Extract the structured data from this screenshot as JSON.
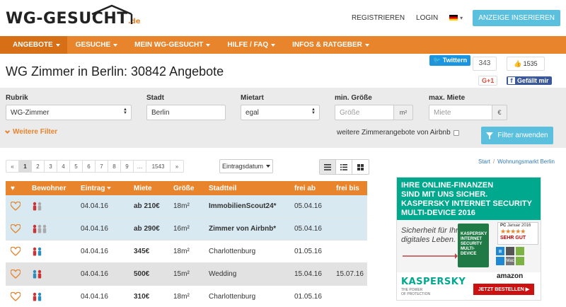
{
  "header": {
    "logo_main": "WG-GESUCHT",
    "logo_suffix": ".de",
    "register": "REGISTRIEREN",
    "login": "LOGIN",
    "cta": "ANZEIGE INSERIEREN"
  },
  "nav": {
    "items": [
      {
        "label": "ANGEBOTE"
      },
      {
        "label": "GESUCHE"
      },
      {
        "label": "MEIN WG-GESUCHT"
      },
      {
        "label": "HILFE / FAQ"
      },
      {
        "label": "INFOS & RATGEBER"
      }
    ]
  },
  "page": {
    "title": "WG Zimmer in Berlin: 30842 Angebote"
  },
  "social": {
    "twitter": "Twittern",
    "twitter_count": "343",
    "gplus": "G+1",
    "like_count": "1535",
    "fb_like": "Gefällt mir"
  },
  "filter": {
    "rubrik_label": "Rubrik",
    "rubrik_value": "WG-Zimmer",
    "stadt_label": "Stadt",
    "stadt_value": "Berlin",
    "mietart_label": "Mietart",
    "mietart_value": "egal",
    "groesse_label": "min. Größe",
    "groesse_placeholder": "Größe",
    "groesse_unit": "m²",
    "miete_label": "max. Miete",
    "miete_placeholder": "Miete",
    "miete_unit": "€",
    "more_filters": "Weitere Filter",
    "airbnb_label": "weitere Zimmerangebote von Airbnb",
    "apply": "Filter anwenden"
  },
  "pagination": {
    "prev": "«",
    "pages": [
      "1",
      "2",
      "3",
      "4",
      "5",
      "6",
      "7",
      "8",
      "9",
      "…",
      "1543"
    ],
    "next": "»",
    "active": "1"
  },
  "sort": {
    "label": "Eintragsdatum"
  },
  "breadcrumb": {
    "start": "Start",
    "sep": "/",
    "current": "Wohnungsmarkt Berlin"
  },
  "table": {
    "headers": {
      "bewohner": "Bewohner",
      "eintrag": "Eintrag",
      "miete": "Miete",
      "groesse": "Größe",
      "stadtteil": "Stadtteil",
      "frei_ab": "frei ab",
      "frei_bis": "frei bis"
    },
    "rows": [
      {
        "eintrag": "04.04.16",
        "miete": "ab 210€",
        "groesse": "18m²",
        "stadtteil": "ImmobilienScout24*",
        "frei_ab": "05.04.16",
        "frei_bis": "",
        "style": "blue"
      },
      {
        "eintrag": "04.04.16",
        "miete": "ab 290€",
        "groesse": "16m²",
        "stadtteil": "Zimmer von Airbnb*",
        "frei_ab": "05.04.16",
        "frei_bis": "",
        "style": "blue"
      },
      {
        "eintrag": "04.04.16",
        "miete": "345€",
        "groesse": "18m²",
        "stadtteil": "Charlottenburg",
        "frei_ab": "01.05.16",
        "frei_bis": "",
        "style": "white"
      },
      {
        "eintrag": "04.04.16",
        "miete": "500€",
        "groesse": "15m²",
        "stadtteil": "Wedding",
        "frei_ab": "15.04.16",
        "frei_bis": "15.07.16",
        "style": "gray"
      },
      {
        "eintrag": "04.04.16",
        "miete": "310€",
        "groesse": "18m²",
        "stadtteil": "Charlottenburg",
        "frei_ab": "01.05.16",
        "frei_bis": "",
        "style": "white"
      }
    ]
  },
  "ad": {
    "headline_1": "IHRE ONLINE-FINANZEN",
    "headline_2": "SIND MIT UNS SICHER.",
    "headline_3": "KASPERSKY INTERNET SECURITY",
    "headline_4": "MULTI-DEVICE 2016",
    "slogan_1": "Sicherheit für Ihr",
    "slogan_2": "digitales Leben.",
    "box_1": "KASPERSKY",
    "box_2": "INTERNET",
    "box_3": "SECURITY",
    "box_4": "MULTI-DEVICE",
    "pc_brand": "PC",
    "pc_month": "Januar 2016",
    "pc_stars": "★★★★★",
    "pc_rating": "SEHR GUT",
    "brand": "KASPERSKY",
    "brand_sub_1": "THE POWER",
    "brand_sub_2": "OF PROTECTION",
    "amazon": "amazon",
    "cta": "JETZT BESTELLEN ▶",
    "tile_1": "⊞",
    "tile_2": "",
    "tile_3": "",
    "tile_4": "",
    "tile_5": "Mac",
    "tile_6": ""
  }
}
